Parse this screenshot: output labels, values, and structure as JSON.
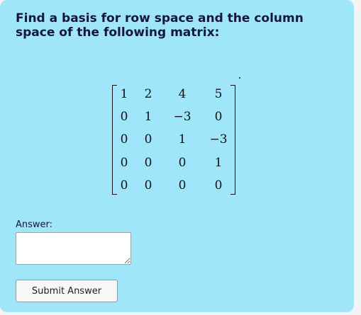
{
  "question": {
    "text": "Find a basis for row space and the column space of the following matrix:"
  },
  "matrix": {
    "rows": [
      [
        "1",
        "2",
        "4",
        "5"
      ],
      [
        "0",
        "1",
        "−3",
        "0"
      ],
      [
        "0",
        "0",
        "1",
        "−3"
      ],
      [
        "0",
        "0",
        "0",
        "1"
      ],
      [
        "0",
        "0",
        "0",
        "0"
      ]
    ]
  },
  "answer": {
    "label": "Answer:",
    "value": "",
    "placeholder": ""
  },
  "submit": {
    "label": "Submit Answer"
  },
  "colors": {
    "card_background": "#9fe6fb",
    "text": "#15173a"
  }
}
